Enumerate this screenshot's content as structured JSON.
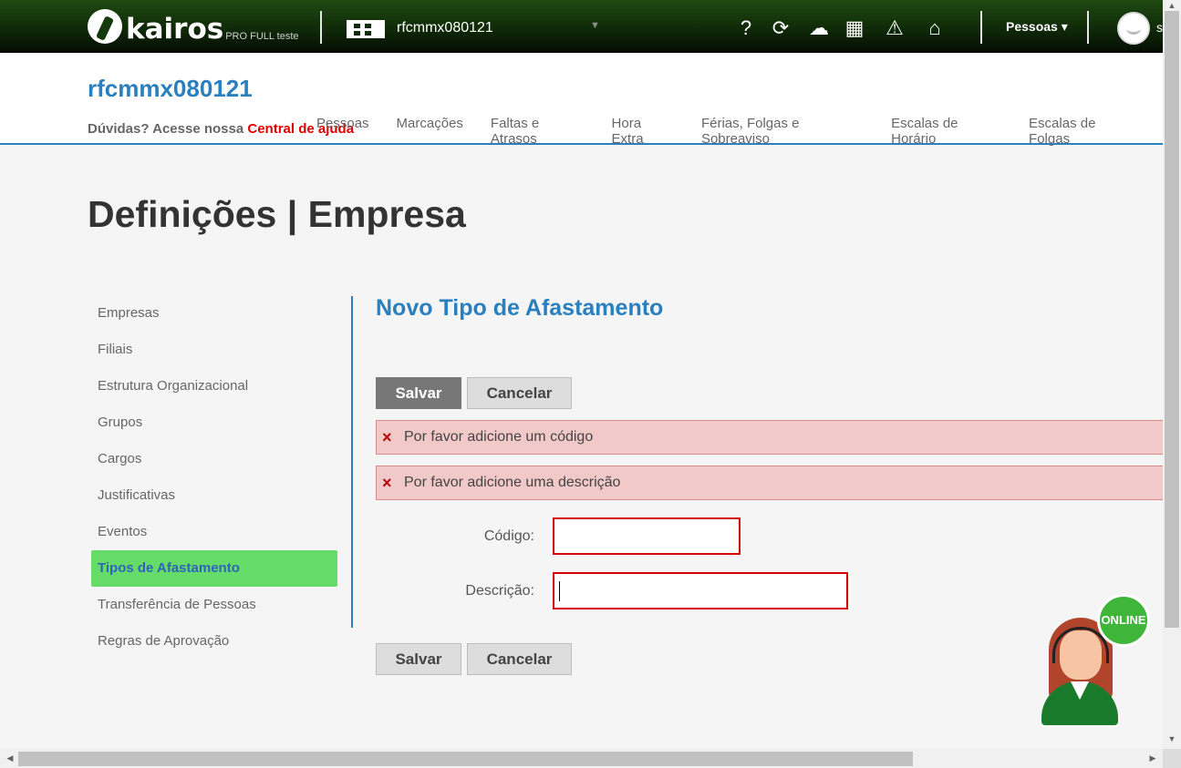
{
  "topbar": {
    "logo_text": "kairos",
    "logo_sub": "PRO FULL teste",
    "company_name": "rfcmmx080121",
    "company_caret": "▼",
    "icons": [
      "help-icon",
      "clock-check-icon",
      "cloud-upload-icon",
      "calculator-icon",
      "warning-icon",
      "inbox-icon"
    ],
    "icon_glyphs": {
      "help": "?",
      "clock": "⟳",
      "cloud": "☁",
      "calc": "▦",
      "warning": "⚠",
      "inbox": "⌂"
    },
    "pessoas_menu": "Pessoas ▾",
    "user_initial": "s"
  },
  "header": {
    "account_title": "rfcmmx080121",
    "help_prefix": "Dúvidas? Acesse nossa ",
    "help_link": "Central de ajuda",
    "nav": [
      "Pessoas",
      "Marcações",
      "Faltas e Atrasos",
      "Hora Extra",
      "Férias, Folgas e Sobreaviso",
      "Escalas de Horário",
      "Escalas de Folgas"
    ]
  },
  "page_title": "Definições | Empresa",
  "sidebar": {
    "items": [
      {
        "label": "Empresas"
      },
      {
        "label": "Filiais"
      },
      {
        "label": "Estrutura Organizacional"
      },
      {
        "label": "Grupos"
      },
      {
        "label": "Cargos"
      },
      {
        "label": "Justificativas"
      },
      {
        "label": "Eventos"
      },
      {
        "label": "Tipos de Afastamento",
        "active": true
      },
      {
        "label": "Transferência de Pessoas"
      },
      {
        "label": "Regras de Aprovação"
      }
    ]
  },
  "form": {
    "title": "Novo Tipo de Afastamento",
    "save_label": "Salvar",
    "cancel_label": "Cancelar",
    "errors": [
      {
        "icon": "×",
        "text": "Por favor adicione um código"
      },
      {
        "icon": "×",
        "text": "Por favor adicione uma descrição"
      }
    ],
    "code_label": "Código:",
    "code_value": "",
    "description_label": "Descrição:",
    "description_value": ""
  },
  "chat": {
    "badge": "ONLINE"
  },
  "colors": {
    "accent": "#2a7fbf",
    "active_menu": "#65dc68",
    "error_bg": "#f2c9c9",
    "error_border": "#d50000",
    "help_link": "#e00000"
  }
}
